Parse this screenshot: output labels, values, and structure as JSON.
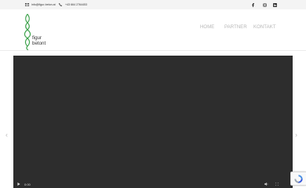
{
  "topbar": {
    "email": "info@figur-beton.at",
    "phone": "+43 664 2764453",
    "social": [
      "facebook-icon",
      "instagram-icon",
      "linkedin-icon"
    ]
  },
  "header": {
    "logo_line1": "figur",
    "logo_line2": "betont",
    "nav": [
      "HOME",
      "PARTNER",
      "KONTAKT"
    ]
  },
  "video": {
    "time": "0:00"
  },
  "colors": {
    "logo_green": "#3fa34d",
    "nav_text": "#b7b7b7",
    "video_bg": "#2d2d2d",
    "topbar_bg": "#f4f4f4"
  }
}
